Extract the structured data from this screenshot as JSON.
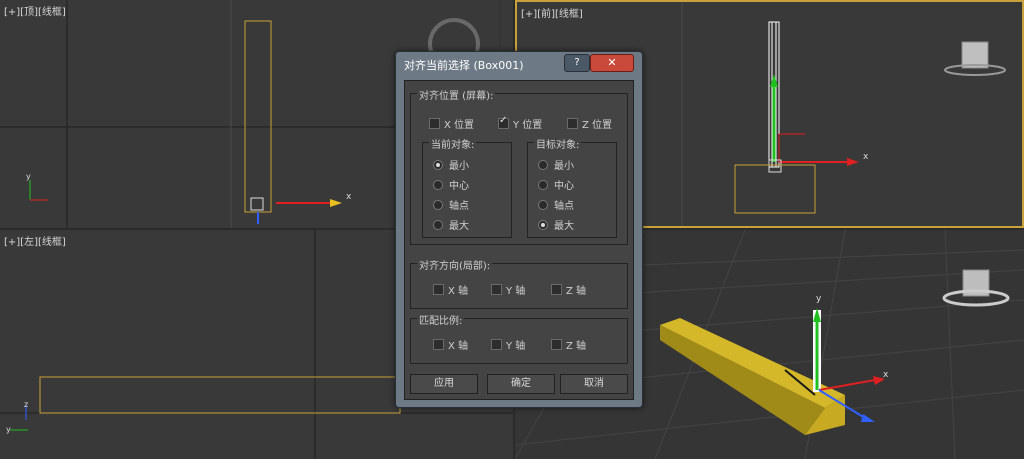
{
  "viewports": {
    "top": {
      "plus": "[+]",
      "name": "[顶]",
      "mode": "[线框]",
      "axis_x": "x",
      "axis_y": "y"
    },
    "front": {
      "plus": "[+]",
      "name": "[前]",
      "mode": "[线框]",
      "axis_x": "x"
    },
    "left": {
      "plus": "[+]",
      "name": "[左]",
      "mode": "[线框]",
      "axis_y": "y",
      "axis_z": "z"
    },
    "persp": {
      "axis_x": "x",
      "axis_y": "y"
    }
  },
  "dialog": {
    "title": "对齐当前选择 (Box001)",
    "help": "?",
    "close": "✕",
    "position_group": {
      "title": "对齐位置 (屏幕):",
      "x": {
        "label": "X 位置",
        "checked": false
      },
      "y": {
        "label": "Y 位置",
        "checked": true
      },
      "z": {
        "label": "Z 位置",
        "checked": false
      }
    },
    "current_object": {
      "title": "当前对象:",
      "options": [
        "最小",
        "中心",
        "轴点",
        "最大"
      ],
      "selected": "最小"
    },
    "target_object": {
      "title": "目标对象:",
      "options": [
        "最小",
        "中心",
        "轴点",
        "最大"
      ],
      "selected": "最大"
    },
    "orientation_group": {
      "title": "对齐方向(局部):",
      "x": "X 轴",
      "y": "Y 轴",
      "z": "Z 轴"
    },
    "scale_group": {
      "title": "匹配比例:",
      "x": "X 轴",
      "y": "Y 轴",
      "z": "Z 轴"
    },
    "buttons": {
      "apply": "应用",
      "ok": "确定",
      "cancel": "取消"
    }
  },
  "colors": {
    "selection": "#c8a13a",
    "axis_x": "#e02020",
    "axis_y": "#20c020",
    "wood": "#c8b020"
  }
}
